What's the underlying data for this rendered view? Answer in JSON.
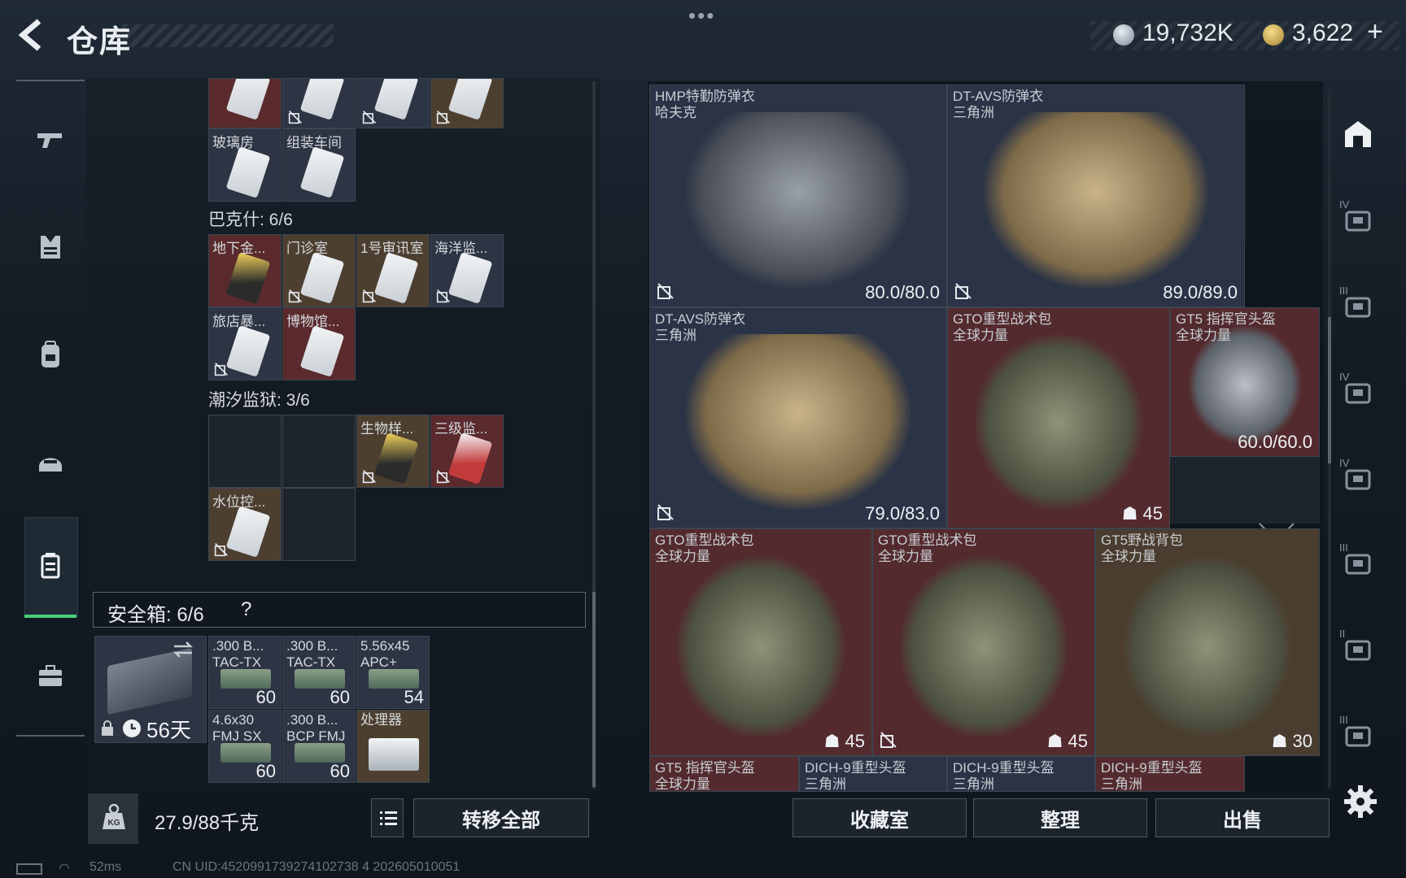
{
  "header": {
    "title": "仓库",
    "dots": "•••",
    "money": "19,732K",
    "gold": "3,622",
    "plus": "+"
  },
  "left_nav": {
    "items": [
      "gun-icon",
      "vest-icon",
      "backpack-icon",
      "helmet-icon",
      "case-icon",
      "briefcase-icon"
    ],
    "active": "case-icon"
  },
  "sections": [
    {
      "id": "top",
      "title": "",
      "cells": [
        {
          "label": "",
          "tint": "red",
          "card": "white",
          "locked": false
        },
        {
          "label": "",
          "tint": "blue",
          "card": "white",
          "locked": true
        },
        {
          "label": "",
          "tint": "blue",
          "card": "white",
          "locked": true
        },
        {
          "label": "",
          "tint": "brown",
          "card": "white",
          "locked": true
        },
        {
          "label": "玻璃房",
          "tint": "blue",
          "card": "white",
          "locked": false
        },
        {
          "label": "组装车间",
          "tint": "blue",
          "card": "white",
          "locked": false
        }
      ]
    },
    {
      "id": "bakesh",
      "title": "巴克什: 6/6",
      "cells": [
        {
          "label": "地下金...",
          "tint": "red",
          "card": "gold",
          "locked": false
        },
        {
          "label": "门诊室",
          "tint": "brown",
          "card": "white",
          "locked": true
        },
        {
          "label": "1号审讯室",
          "tint": "brown",
          "card": "white",
          "locked": true
        },
        {
          "label": "海洋监...",
          "tint": "blue",
          "card": "white",
          "locked": true
        },
        {
          "label": "旅店暴...",
          "tint": "blue",
          "card": "white",
          "locked": true
        },
        {
          "label": "博物馆...",
          "tint": "red",
          "card": "white",
          "locked": false
        }
      ]
    },
    {
      "id": "prison",
      "title": "潮汐监狱: 3/6",
      "cells": [
        {
          "label": "",
          "tint": "dark",
          "card": "",
          "locked": false
        },
        {
          "label": "",
          "tint": "dark",
          "card": "",
          "locked": false
        },
        {
          "label": "生物样...",
          "tint": "brown",
          "card": "gold",
          "locked": true
        },
        {
          "label": "三级监...",
          "tint": "red",
          "card": "redc",
          "locked": true
        },
        {
          "label": "水位控...",
          "tint": "brown",
          "card": "white",
          "locked": true
        },
        {
          "label": "",
          "tint": "dark",
          "card": "",
          "locked": false
        }
      ]
    }
  ],
  "safe": {
    "label": "安全箱: 6/6",
    "help": "?",
    "days": "56天"
  },
  "safe_items": [
    {
      "name": ".300 B... TAC-TX",
      "count": "60",
      "tint": "blue"
    },
    {
      "name": ".300 B... TAC-TX",
      "count": "60",
      "tint": "blue"
    },
    {
      "name": "5.56x45 APC+",
      "count": "54",
      "tint": "blue"
    },
    {
      "name": "4.6x30 FMJ SX",
      "count": "60",
      "tint": "blue"
    },
    {
      "name": ".300 B... BCP FMJ",
      "count": "60",
      "tint": "blue"
    },
    {
      "name": "处理器",
      "count": "",
      "tint": "brown"
    }
  ],
  "bottom_left": {
    "weight": "27.9/88千克",
    "transfer": "转移全部"
  },
  "status": {
    "ping": "52ms",
    "uid": "CN UID:4520991739274102738 4 202605010051"
  },
  "stash_items": [
    {
      "name": "HMP特勤防弹衣",
      "maker": "哈夫克",
      "value": "80.0/80.0",
      "tint": "navy",
      "art": "vest-gray",
      "locked": true
    },
    {
      "name": "DT-AVS防弹衣",
      "maker": "三角洲",
      "value": "89.0/89.0",
      "tint": "navy",
      "art": "vest-tan",
      "locked": true
    },
    {
      "name": "DT-AVS防弹衣",
      "maker": "三角洲",
      "value": "79.0/83.0",
      "tint": "navy",
      "art": "vest-tan",
      "locked": true
    },
    {
      "name": "GTO重型战术包",
      "maker": "全球力量",
      "value": "45",
      "tint": "red",
      "art": "pack-green",
      "locked": false
    },
    {
      "name": "GT5 指挥官头盔",
      "maker": "全球力量",
      "value": "60.0/60.0",
      "tint": "red",
      "art": "helm",
      "locked": false
    },
    {
      "name": "GTO重型战术包",
      "maker": "全球力量",
      "value": "45",
      "tint": "red",
      "art": "pack-green",
      "locked": false
    },
    {
      "name": "GTO重型战术包",
      "maker": "全球力量",
      "value": "45",
      "tint": "red",
      "art": "pack-green",
      "locked": true
    },
    {
      "name": "GT5野战背包",
      "maker": "全球力量",
      "value": "30",
      "tint": "brownbg",
      "art": "pack-green",
      "locked": false
    },
    {
      "name": "GT5 指挥官头盔",
      "maker": "全球力量",
      "value": "",
      "tint": "red",
      "art": "",
      "locked": false
    },
    {
      "name": "DICH-9重型头盔",
      "maker": "三角洲",
      "value": "",
      "tint": "navy",
      "art": "",
      "locked": false
    },
    {
      "name": "DICH-9重型头盔",
      "maker": "三角洲",
      "value": "",
      "tint": "navy",
      "art": "",
      "locked": false
    },
    {
      "name": "DICH-9重型头盔",
      "maker": "三角洲",
      "value": "",
      "tint": "red",
      "art": "",
      "locked": false
    }
  ],
  "bottom_right": {
    "collection": "收藏室",
    "sort": "整理",
    "sell": "出售"
  },
  "right_rail": [
    {
      "icon": "stash-icon",
      "label": ""
    },
    {
      "icon": "tier4-vest-icon",
      "label": "IV"
    },
    {
      "icon": "tier3-armor-icon",
      "label": "III"
    },
    {
      "icon": "tier4-armor-icon",
      "label": "IV"
    },
    {
      "icon": "tier4-box-icon",
      "label": "IV"
    },
    {
      "icon": "tier3-gun-icon",
      "label": "III"
    },
    {
      "icon": "tier2-med-icon",
      "label": "II"
    },
    {
      "icon": "tier3-misc-icon",
      "label": "III"
    }
  ],
  "colors": {
    "accent_green": "#4ad07a",
    "red_tint": "#532a2e",
    "navy_tint": "#2b3346",
    "brown_tint": "#4a3c2e"
  }
}
